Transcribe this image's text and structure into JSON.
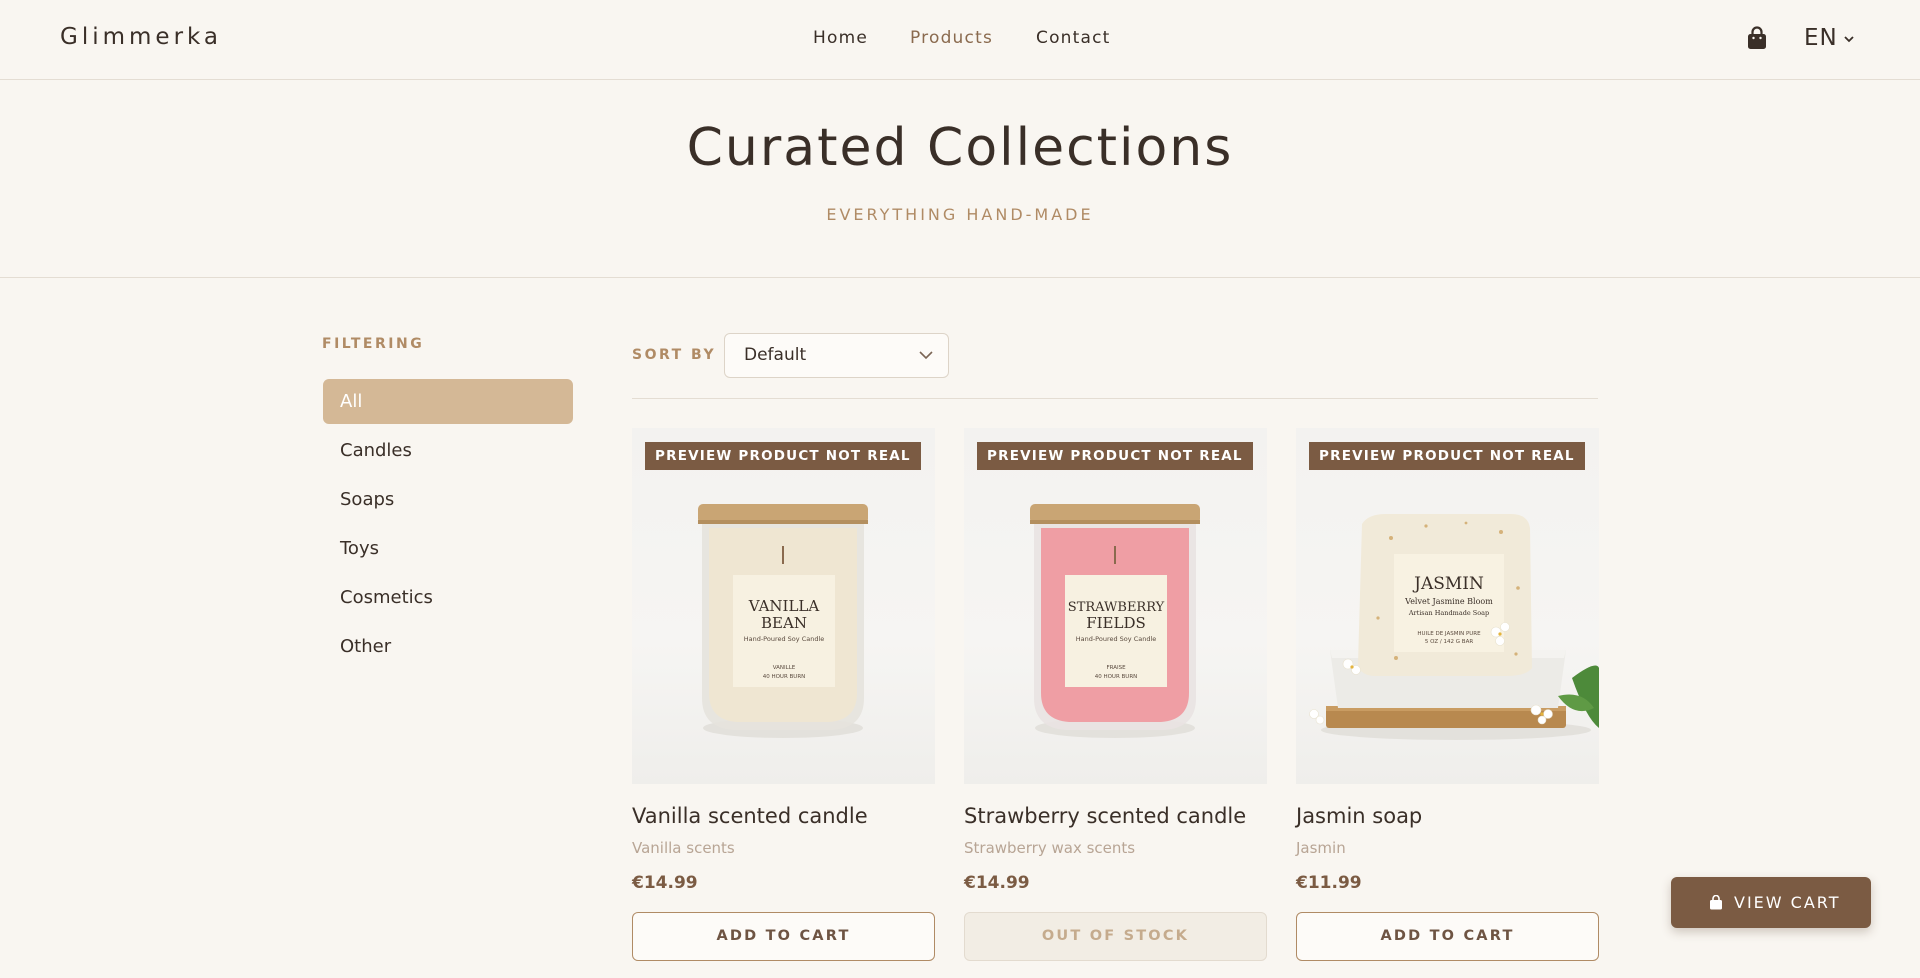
{
  "header": {
    "logo": "Glimmerka",
    "nav": [
      {
        "label": "Home",
        "active": false
      },
      {
        "label": "Products",
        "active": true
      },
      {
        "label": "Contact",
        "active": false
      }
    ],
    "cart_icon": "shopping-bag-icon",
    "language": "EN"
  },
  "hero": {
    "title": "Curated Collections",
    "subtitle": "EVERYTHING HAND-MADE"
  },
  "filters": {
    "title": "FILTERING",
    "items": [
      {
        "label": "All",
        "active": true
      },
      {
        "label": "Candles",
        "active": false
      },
      {
        "label": "Soaps",
        "active": false
      },
      {
        "label": "Toys",
        "active": false
      },
      {
        "label": "Cosmetics",
        "active": false
      },
      {
        "label": "Other",
        "active": false
      }
    ]
  },
  "sort": {
    "label": "SORT BY",
    "value": "Default"
  },
  "products": [
    {
      "badge": "PREVIEW PRODUCT NOT REAL",
      "name": "Vanilla scented candle",
      "subtitle": "Vanilla scents",
      "price": "€14.99",
      "button": "ADD TO CART",
      "in_stock": true,
      "image": {
        "kind": "candle",
        "wax_color": "#efe6d2",
        "label_lines": [
          "VANILLA",
          "BEAN"
        ],
        "label_small": "Hand-Poured Soy Candle",
        "label_tiny": [
          "VANILLE",
          "40 HOUR BURN"
        ]
      }
    },
    {
      "badge": "PREVIEW PRODUCT NOT REAL",
      "name": "Strawberry scented candle",
      "subtitle": "Strawberry wax scents",
      "price": "€14.99",
      "button": "OUT OF STOCK",
      "in_stock": false,
      "image": {
        "kind": "candle",
        "wax_color": "#ef9ea4",
        "label_lines": [
          "STRAWBERRY",
          "FIELDS"
        ],
        "label_small": "Hand-Poured Soy Candle",
        "label_tiny": [
          "FRAISE",
          "40 HOUR BURN"
        ]
      }
    },
    {
      "badge": "PREVIEW PRODUCT NOT REAL",
      "name": "Jasmin soap",
      "subtitle": "Jasmin",
      "price": "€11.99",
      "button": "ADD TO CART",
      "in_stock": true,
      "image": {
        "kind": "soap",
        "label_lines": [
          "JASMIN"
        ],
        "label_small": "Velvet Jasmine Bloom",
        "label_small2": "Artisan Handmade Soap",
        "label_tiny": [
          "HUILE DE JASMIN PURE",
          "5 OZ / 142 G BAR"
        ]
      }
    }
  ],
  "view_cart": {
    "label": "VIEW CART",
    "icon": "shopping-bag-icon"
  },
  "colors": {
    "background": "#f9f6f1",
    "accent": "#7b5b43",
    "accent_light": "#d4b896",
    "muted_gold": "#b08b65",
    "text": "#3a2f28"
  }
}
